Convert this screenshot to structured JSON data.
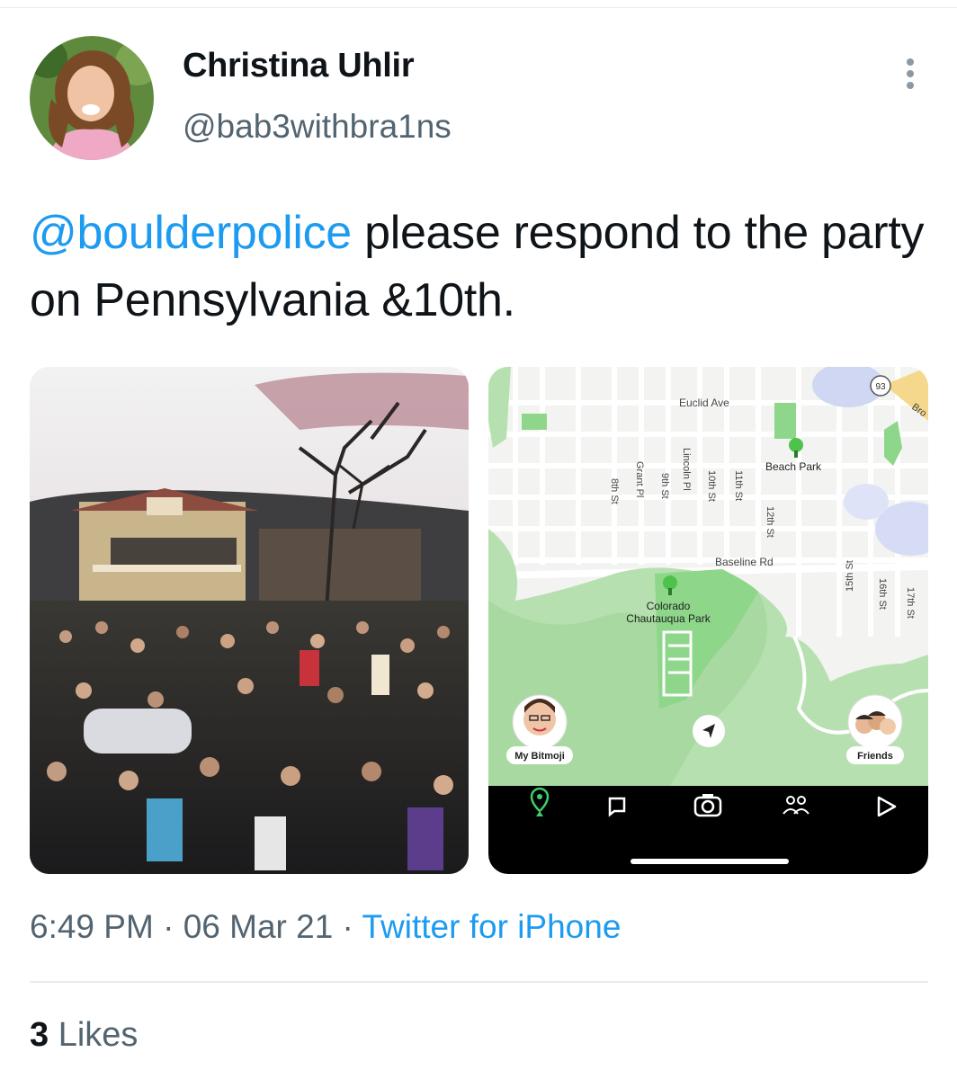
{
  "tweet": {
    "author_name": "Christina Uhlir",
    "author_handle": "@bab3withbra1ns",
    "mention": "@boulderpolice",
    "text": " please respond to the party on Pennsylvania &10th.",
    "time": "6:49 PM",
    "date": "06 Mar 21",
    "source": "Twitter for iPhone",
    "likes_count": "3",
    "likes_label": "Likes"
  },
  "map": {
    "streets": {
      "euclid": "Euclid Ave",
      "baseline": "Baseline Rd",
      "eighth": "8th St",
      "grant": "Grant Pl",
      "ninth": "9th St",
      "lincoln": "Lincoln Pl",
      "tenth": "10th St",
      "eleventh": "11th St",
      "twelfth": "12th St",
      "fifteenth": "15th St",
      "sixteenth": "16th St",
      "seventeenth": "17th St",
      "broadway": "Bro"
    },
    "route_badge": "93",
    "beach_park": "Beach Park",
    "chautauqua_line1": "Colorado",
    "chautauqua_line2": "Chautauqua Park",
    "my_bitmoji": "My Bitmoji",
    "friends": "Friends"
  },
  "icons": [
    "more-options-icon",
    "map-pin-icon",
    "chat-icon",
    "camera-icon",
    "friends-icon",
    "play-icon",
    "compass-arrow-icon",
    "tree-icon"
  ],
  "colors": {
    "link": "#1d9bf0",
    "secondary": "#536471",
    "map_green": "#8dd68a",
    "snap_bar": "#000000"
  }
}
